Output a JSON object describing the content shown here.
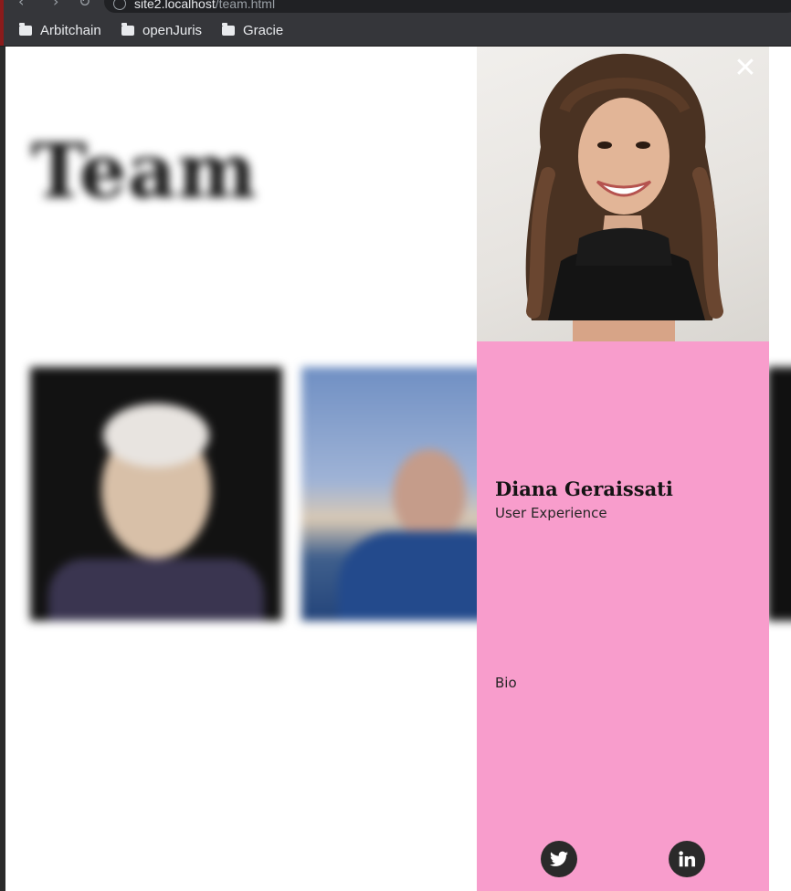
{
  "browser": {
    "url_host": "site2.localhost",
    "url_path": "/team.html",
    "bookmarks": [
      {
        "label": "Arbitchain",
        "icon": "folder-icon"
      },
      {
        "label": "openJuris",
        "icon": "folder-icon"
      },
      {
        "label": "Gracie",
        "icon": "folder-icon"
      }
    ]
  },
  "page": {
    "title": "Team"
  },
  "modal": {
    "close_label": "✕",
    "name": "Diana Geraissati",
    "role": "User Experience",
    "bio": "Bio",
    "social": [
      {
        "icon": "twitter-icon"
      },
      {
        "icon": "linkedin-icon"
      }
    ]
  },
  "colors": {
    "modal_bg": "#f89dcc",
    "chrome_bg": "#35363a",
    "social_bg": "#2a2a2a"
  }
}
